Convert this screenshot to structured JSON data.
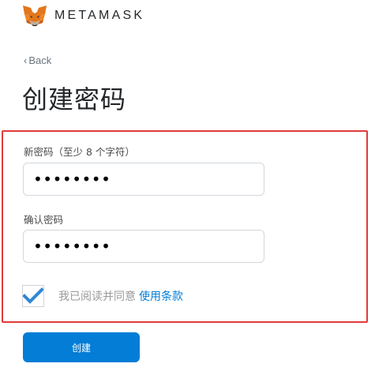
{
  "header": {
    "brand": "METAMASK",
    "logo_icon": "metamask-fox-icon"
  },
  "nav": {
    "back_label": "Back"
  },
  "page": {
    "title": "创建密码"
  },
  "form": {
    "new_password": {
      "label": "新密码（至少 8 个字符）",
      "value": "••••••••"
    },
    "confirm_password": {
      "label": "确认密码",
      "value": "••••••••"
    },
    "terms": {
      "checked": true,
      "text": "我已阅读并同意",
      "link": "使用条款"
    },
    "submit_label": "创建"
  },
  "colors": {
    "accent": "#037dd6",
    "highlight": "#e03b3b",
    "checkmark": "#2f86d6"
  }
}
